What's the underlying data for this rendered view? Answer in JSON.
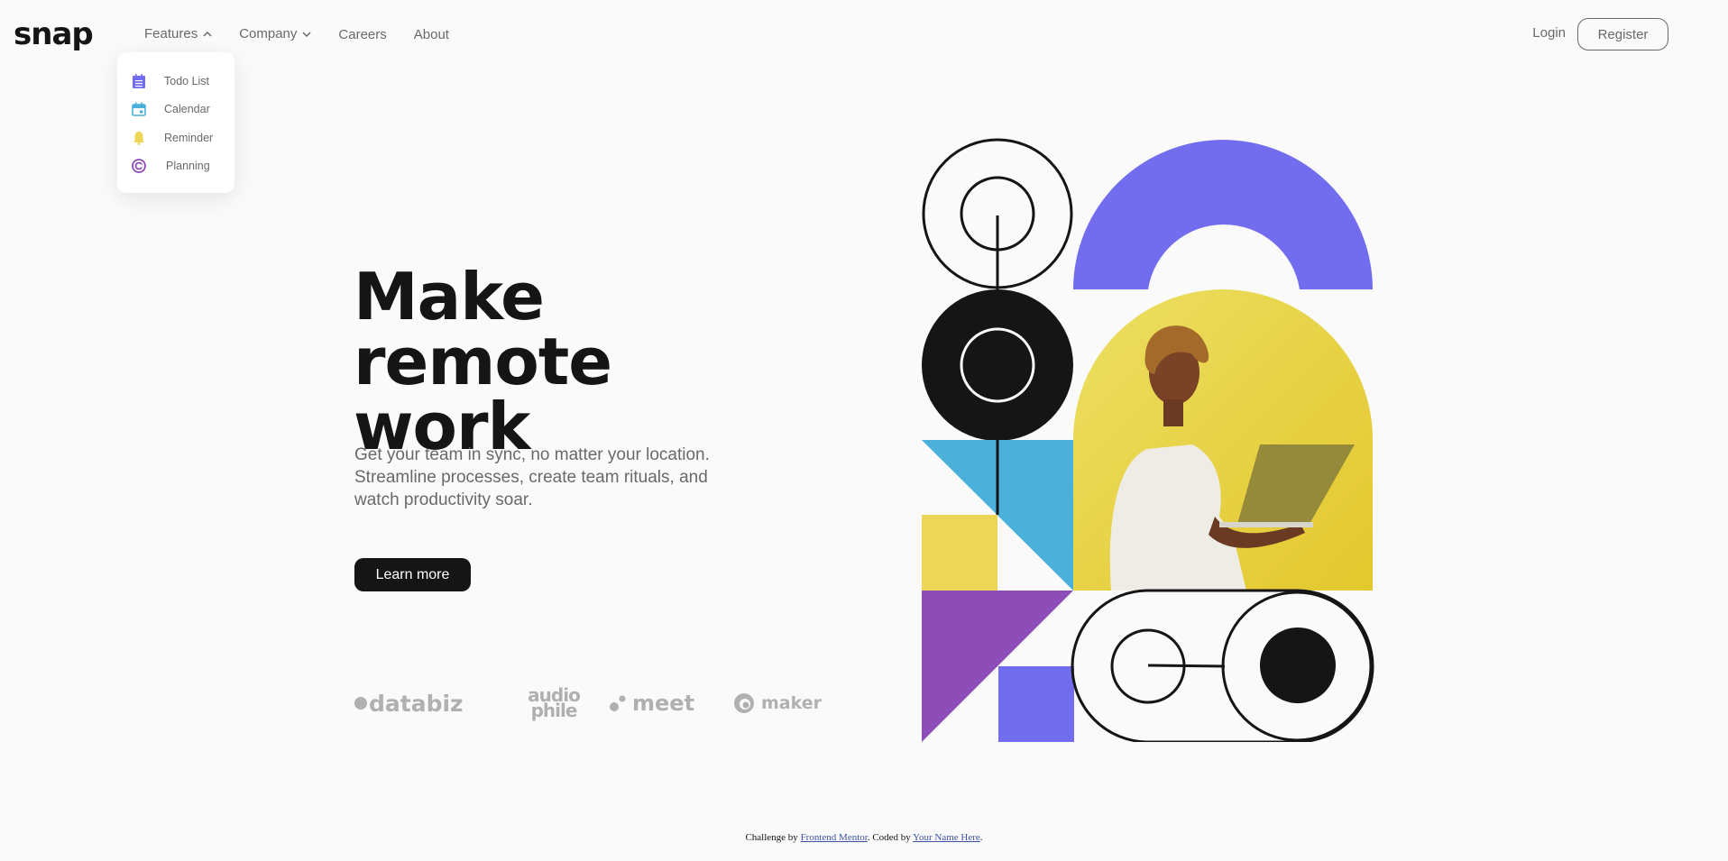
{
  "brand": {
    "logo": "snap"
  },
  "nav": {
    "features": "Features",
    "company": "Company",
    "careers": "Careers",
    "about": "About"
  },
  "features_menu": [
    {
      "label": "Todo List",
      "icon": "todo-list-icon",
      "color": "#726cee"
    },
    {
      "label": "Calendar",
      "icon": "calendar-icon",
      "color": "#4bb1da"
    },
    {
      "label": "Reminder",
      "icon": "bell-icon",
      "color": "#edd556"
    },
    {
      "label": "Planning",
      "icon": "planning-icon",
      "color": "#8e4cb6"
    }
  ],
  "auth": {
    "login": "Login",
    "register": "Register"
  },
  "hero": {
    "title_line1": "Make remote",
    "title_line2": "work",
    "subtitle": "Get your team in sync, no matter your location. Streamline processes, create team rituals, and watch productivity soar.",
    "cta": "Learn more"
  },
  "clients": {
    "databiz": "databiz",
    "audiophile_1": "audio",
    "audiophile_2": "phile",
    "meet": "meet",
    "maker": "maker"
  },
  "footer": {
    "prefix": "Challenge by ",
    "link1": "Frontend Mentor",
    "middle": ". Coded by ",
    "link2": "Your Name Here",
    "suffix": "."
  },
  "colors": {
    "purple": "#726cee",
    "blue": "#4bb1da",
    "yellow": "#edd556",
    "violet": "#8e4cb6",
    "black": "#151515",
    "gray": "#696969"
  }
}
